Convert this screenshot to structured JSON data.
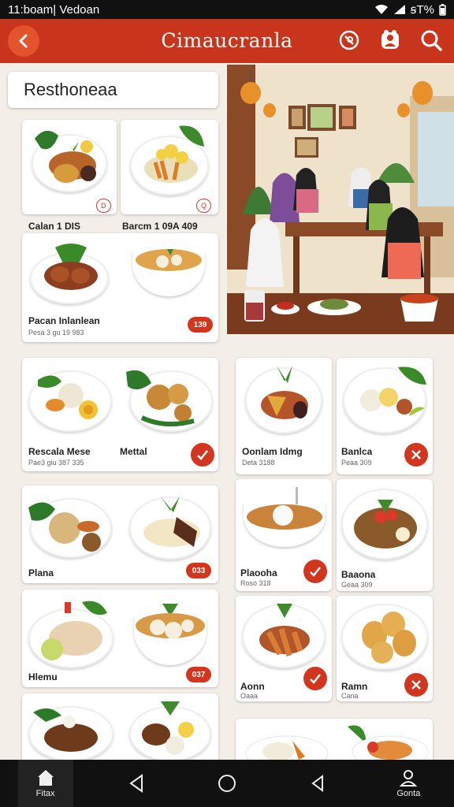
{
  "status": {
    "time": "11:⁠boam| Vedoan",
    "battery": "ꞩT%"
  },
  "header": {
    "title": "Cimaucranla"
  },
  "search": {
    "text": "Resthoneaa"
  },
  "cards": {
    "c1": {
      "name": "Calan 1 DIS",
      "badge": "D"
    },
    "c2": {
      "name": "Barcm 1 09A 409",
      "badge": "Q"
    },
    "c3": {
      "name": "Pacan Inlanlean",
      "sub": "Pesa 3 gu 19 983",
      "badge": "139"
    },
    "c4": {
      "name": "Rescala Mese",
      "name2": "Mettal",
      "sub": "Pae3 giu 387 335"
    },
    "c5": {
      "name": "Oonlam Idmg",
      "sub": "Deta 3188"
    },
    "c6": {
      "name": "Banlca",
      "sub": "Peaa 309"
    },
    "c7": {
      "name": "Plana",
      "badge": "033"
    },
    "c8": {
      "name": "Plaooha",
      "sub": "Roso 318"
    },
    "c9": {
      "name": "Baaona",
      "sub": "Geaa 309"
    },
    "c10": {
      "name": "Hlemu",
      "badge": "037"
    },
    "c11": {
      "name": "Aonn",
      "sub": "Oaaa"
    },
    "c12": {
      "name": "Ramn",
      "sub": "Cana"
    }
  },
  "nav": {
    "home": "Fitax",
    "profile": "Gonta"
  },
  "colors": {
    "accent": "#c8341c",
    "badge": "#d3361e"
  }
}
